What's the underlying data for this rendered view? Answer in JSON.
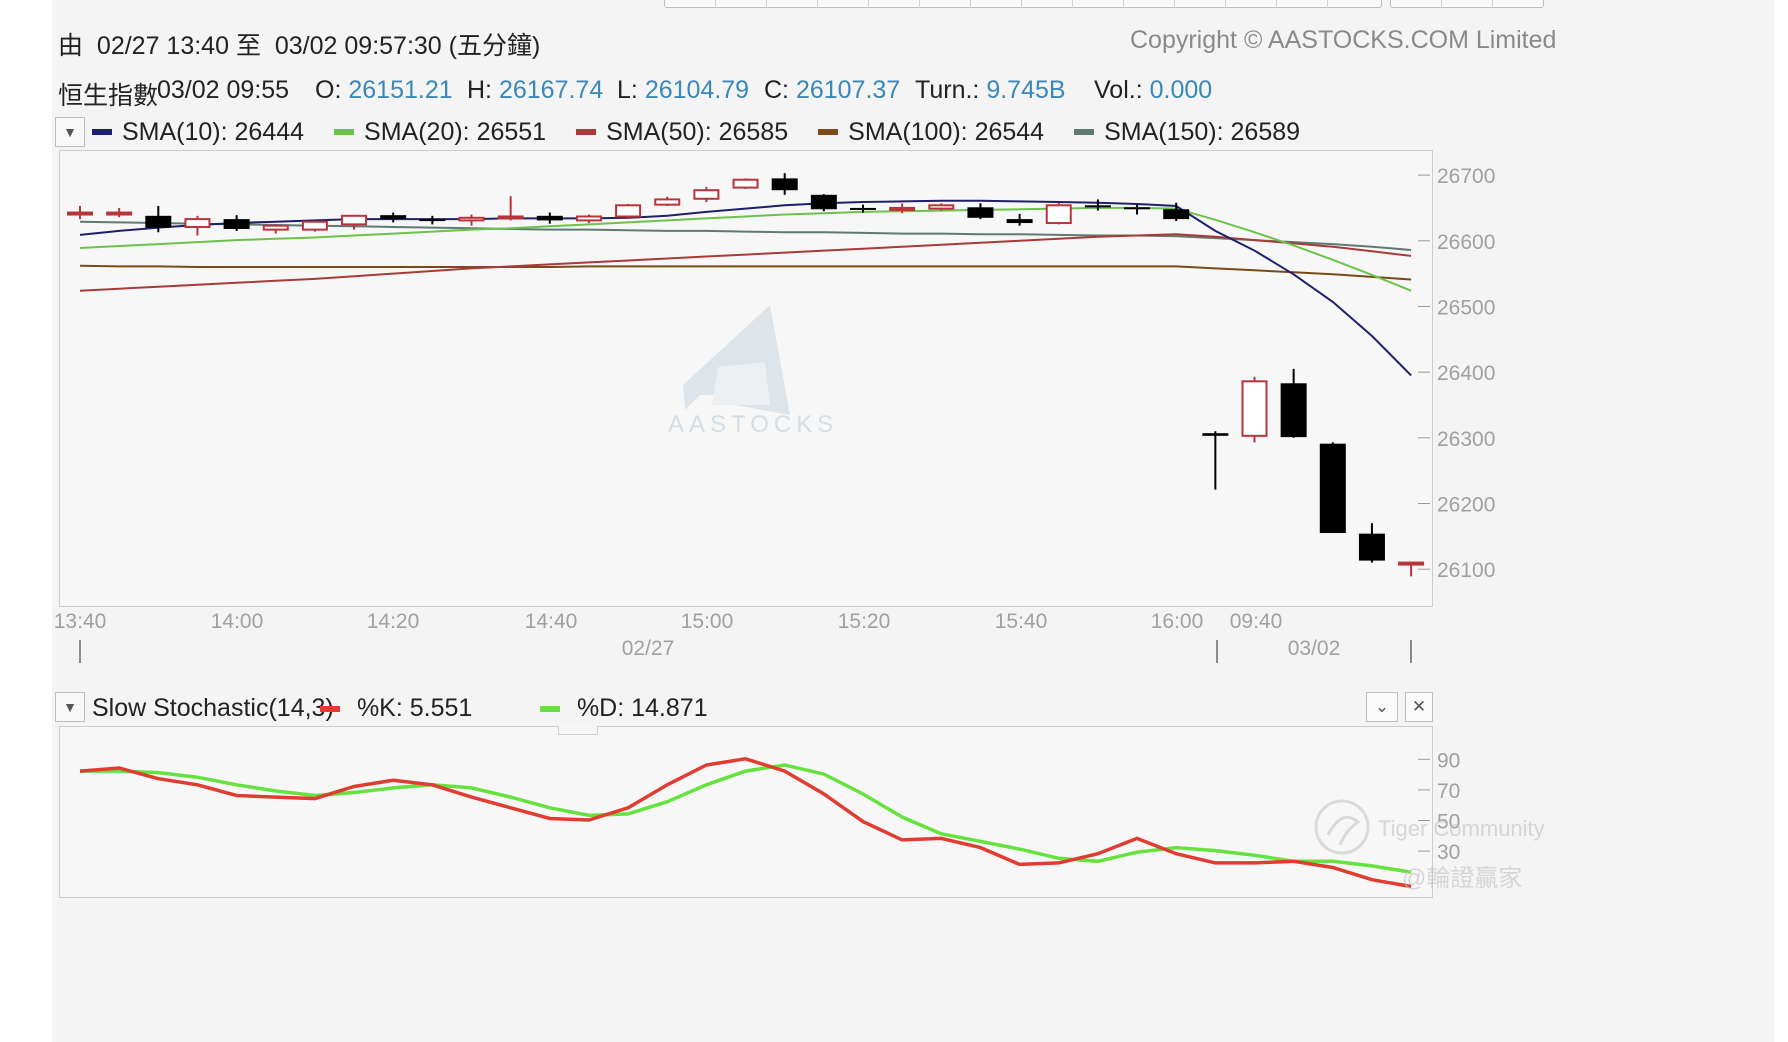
{
  "header": {
    "range_prefix": "由",
    "range_start": "02/27 13:40",
    "range_sep": "至",
    "range_end": "03/02 09:57:30",
    "interval": "(五分鐘)",
    "copyright": "Copyright © AASTOCKS.COM Limited"
  },
  "quote": {
    "name": "恒生指數",
    "time": "03/02 09:55",
    "open_label": "O:",
    "open": "26151.21",
    "high_label": "H:",
    "high": "26167.74",
    "low_label": "L:",
    "low": "26104.79",
    "close_label": "C:",
    "close": "26107.37",
    "turn_label": "Turn.:",
    "turn": "9.745B",
    "vol_label": "Vol.:",
    "vol": "0.000"
  },
  "sma_legend": [
    {
      "label": "SMA(10): 26444",
      "color": "#1f1f6b"
    },
    {
      "label": "SMA(20): 26551",
      "color": "#6cc24a"
    },
    {
      "label": "SMA(50): 26585",
      "color": "#a83a3a"
    },
    {
      "label": "SMA(100): 26544",
      "color": "#7a4a1a"
    },
    {
      "label": "SMA(150): 26589",
      "color": "#5f7a72"
    }
  ],
  "stoch_legend": {
    "title": "Slow Stochastic(14,3)",
    "k_label": "%K: 5.551",
    "d_label": "%D: 14.871",
    "k_color": "#e03c31",
    "d_color": "#66e23f"
  },
  "watermark": {
    "brand": "AASTOCKS",
    "community": "Tiger Community",
    "author": "@輪證贏家"
  },
  "colors": {
    "up_candle": "#b8343c",
    "down_candle": "#000000",
    "value_blue": "#3a87b8"
  },
  "chart_data": [
    {
      "type": "candlestick",
      "title": "恒生指數",
      "ylim": [
        26050,
        26720
      ],
      "y_ticks": [
        26700,
        26600,
        26500,
        26400,
        26300,
        26200,
        26100
      ],
      "x_tick_labels": [
        "13:40",
        "14:00",
        "14:20",
        "14:40",
        "15:00",
        "15:20",
        "15:40",
        "16:00",
        "09:40"
      ],
      "date_labels": [
        "02/27",
        "03/02"
      ],
      "candles": [
        {
          "o": 26640,
          "h": 26650,
          "l": 26630,
          "c": 26640
        },
        {
          "o": 26640,
          "h": 26647,
          "l": 26633,
          "c": 26640
        },
        {
          "o": 26635,
          "h": 26650,
          "l": 26610,
          "c": 26617
        },
        {
          "o": 26618,
          "h": 26635,
          "l": 26605,
          "c": 26630
        },
        {
          "o": 26630,
          "h": 26636,
          "l": 26612,
          "c": 26615
        },
        {
          "o": 26614,
          "h": 26622,
          "l": 26608,
          "c": 26620
        },
        {
          "o": 26614,
          "h": 26628,
          "l": 26611,
          "c": 26626
        },
        {
          "o": 26622,
          "h": 26636,
          "l": 26614,
          "c": 26635
        },
        {
          "o": 26636,
          "h": 26640,
          "l": 26625,
          "c": 26630
        },
        {
          "o": 26630,
          "h": 26635,
          "l": 26622,
          "c": 26628
        },
        {
          "o": 26628,
          "h": 26637,
          "l": 26620,
          "c": 26632
        },
        {
          "o": 26632,
          "h": 26665,
          "l": 26628,
          "c": 26634
        },
        {
          "o": 26635,
          "h": 26640,
          "l": 26623,
          "c": 26628
        },
        {
          "o": 26628,
          "h": 26637,
          "l": 26624,
          "c": 26634
        },
        {
          "o": 26634,
          "h": 26653,
          "l": 26630,
          "c": 26651
        },
        {
          "o": 26652,
          "h": 26664,
          "l": 26650,
          "c": 26660
        },
        {
          "o": 26661,
          "h": 26679,
          "l": 26656,
          "c": 26674
        },
        {
          "o": 26678,
          "h": 26692,
          "l": 26676,
          "c": 26690
        },
        {
          "o": 26692,
          "h": 26700,
          "l": 26667,
          "c": 26674
        },
        {
          "o": 26667,
          "h": 26668,
          "l": 26642,
          "c": 26645
        },
        {
          "o": 26647,
          "h": 26652,
          "l": 26640,
          "c": 26645
        },
        {
          "o": 26644,
          "h": 26654,
          "l": 26639,
          "c": 26647
        },
        {
          "o": 26646,
          "h": 26654,
          "l": 26643,
          "c": 26651
        },
        {
          "o": 26648,
          "h": 26654,
          "l": 26630,
          "c": 26632
        },
        {
          "o": 26630,
          "h": 26638,
          "l": 26620,
          "c": 26624
        },
        {
          "o": 26624,
          "h": 26655,
          "l": 26622,
          "c": 26651
        },
        {
          "o": 26651,
          "h": 26660,
          "l": 26643,
          "c": 26650
        },
        {
          "o": 26648,
          "h": 26652,
          "l": 26637,
          "c": 26646
        },
        {
          "o": 26645,
          "h": 26655,
          "l": 26627,
          "c": 26630
        },
        {
          "o": 26304,
          "h": 26307,
          "l": 26218,
          "c": 26300
        },
        {
          "o": 26300,
          "h": 26390,
          "l": 26290,
          "c": 26383
        },
        {
          "o": 26380,
          "h": 26402,
          "l": 26297,
          "c": 26298
        },
        {
          "o": 26288,
          "h": 26290,
          "l": 26152,
          "c": 26152
        },
        {
          "o": 26151,
          "h": 26167,
          "l": 26107,
          "c": 26110
        },
        {
          "o": 26105,
          "h": 26108,
          "l": 26086,
          "c": 26107
        }
      ],
      "series": [
        {
          "name": "SMA(10)",
          "values": [
            26606,
            26612,
            26617,
            26621,
            26624,
            26626,
            26628,
            26630,
            26630,
            26630,
            26630,
            26631,
            26631,
            26631,
            26632,
            26635,
            26641,
            26646,
            26651,
            26654,
            26656,
            26657,
            26658,
            26658,
            26657,
            26656,
            26655,
            26653,
            26650,
            26612,
            26582,
            26546,
            26504,
            26452,
            26392
          ]
        },
        {
          "name": "SMA(20)",
          "values": [
            26586,
            26589,
            26592,
            26595,
            26598,
            26600,
            26602,
            26605,
            26608,
            26611,
            26614,
            26616,
            26619,
            26622,
            26625,
            26628,
            26631,
            26634,
            26637,
            26639,
            26641,
            26642,
            26643,
            26644,
            26645,
            26646,
            26647,
            26647,
            26646,
            26629,
            26610,
            26590,
            26568,
            26545,
            26521
          ]
        },
        {
          "name": "SMA(50)",
          "values": [
            26521,
            26524,
            26527,
            26530,
            26533,
            26536,
            26539,
            26543,
            26547,
            26551,
            26555,
            26558,
            26561,
            26564,
            26567,
            26570,
            26573,
            26576,
            26579,
            26582,
            26585,
            26588,
            26591,
            26594,
            26597,
            26600,
            26603,
            26605,
            26607,
            26603,
            26598,
            26593,
            26588,
            26581,
            26574
          ]
        },
        {
          "name": "SMA(100)",
          "values": [
            26559,
            26558,
            26558,
            26557,
            26557,
            26557,
            26557,
            26557,
            26557,
            26557,
            26557,
            26557,
            26557,
            26558,
            26558,
            26558,
            26558,
            26558,
            26558,
            26558,
            26558,
            26558,
            26558,
            26558,
            26558,
            26558,
            26558,
            26558,
            26558,
            26555,
            26552,
            26549,
            26546,
            26542,
            26538
          ]
        },
        {
          "name": "SMA(150)",
          "values": [
            26626,
            26625,
            26624,
            26623,
            26622,
            26621,
            26620,
            26619,
            26618,
            26617,
            26616,
            26615,
            26614,
            26614,
            26613,
            26612,
            26612,
            26611,
            26610,
            26610,
            26609,
            26608,
            26608,
            26607,
            26607,
            26606,
            26605,
            26605,
            26604,
            26601,
            26598,
            26595,
            26592,
            26588,
            26583
          ]
        }
      ]
    },
    {
      "type": "line",
      "title": "Slow Stochastic(14,3)",
      "ylim": [
        0,
        100
      ],
      "y_ticks": [
        90,
        70,
        50,
        30
      ],
      "series": [
        {
          "name": "%K",
          "values": [
            81,
            83,
            76,
            72,
            65,
            64,
            63,
            71,
            75,
            72,
            64,
            57,
            50,
            49,
            57,
            72,
            85,
            89,
            81,
            66,
            48,
            36,
            37,
            31,
            20,
            21,
            27,
            37,
            27,
            21,
            21,
            22,
            18,
            10,
            5.551
          ]
        },
        {
          "name": "%D",
          "values": [
            81,
            81,
            80,
            77,
            72,
            68,
            65,
            67,
            70,
            72,
            70,
            64,
            57,
            52,
            53,
            61,
            72,
            81,
            85,
            79,
            66,
            51,
            40,
            35,
            30,
            24,
            22,
            28,
            31,
            29,
            26,
            22,
            22,
            19,
            14.871
          ]
        }
      ]
    }
  ]
}
